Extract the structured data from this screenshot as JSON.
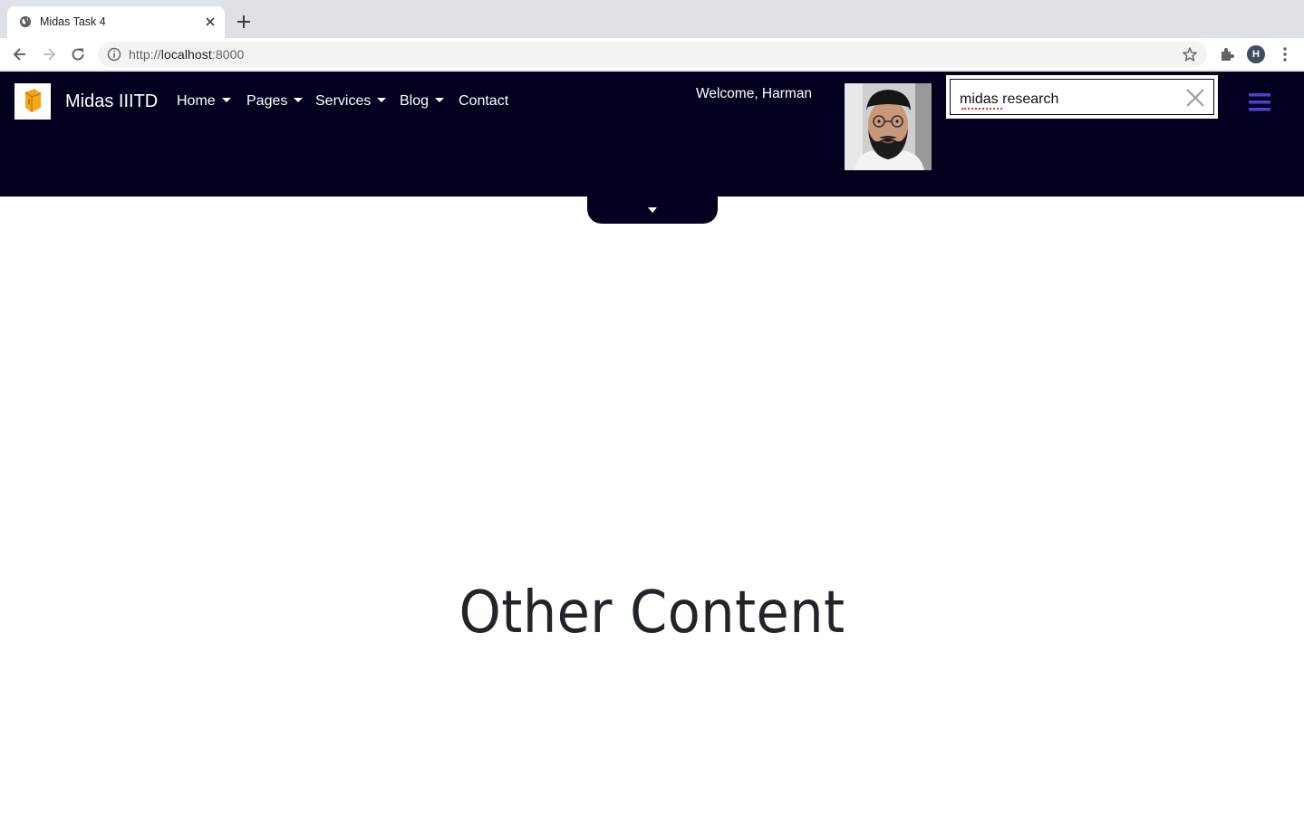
{
  "browser": {
    "tab_title": "Midas Task 4",
    "url_scheme": "http://",
    "url_host": "localhost",
    "url_port": ":8000",
    "profile_initial": "H"
  },
  "navbar": {
    "brand": "Midas IIITD",
    "items": [
      {
        "label": "Home",
        "dropdown": true
      },
      {
        "label": "Pages",
        "dropdown": true
      },
      {
        "label": "Services",
        "dropdown": true
      },
      {
        "label": "Blog",
        "dropdown": true
      },
      {
        "label": "Contact",
        "dropdown": false
      }
    ],
    "welcome": "Welcome, Harman",
    "search_value": "midas research",
    "background_color": "#02001e",
    "accent_color": "#4f3fd1"
  },
  "content": {
    "heading": "Other Content"
  },
  "icons": [
    "globe-icon",
    "close-icon",
    "plus-icon",
    "back-arrow-icon",
    "forward-arrow-icon",
    "reload-icon",
    "info-icon",
    "star-icon",
    "extensions-icon",
    "kebab-menu-icon",
    "brand-logo-icon",
    "clear-search-icon",
    "hamburger-menu-icon",
    "caret-down-icon"
  ]
}
